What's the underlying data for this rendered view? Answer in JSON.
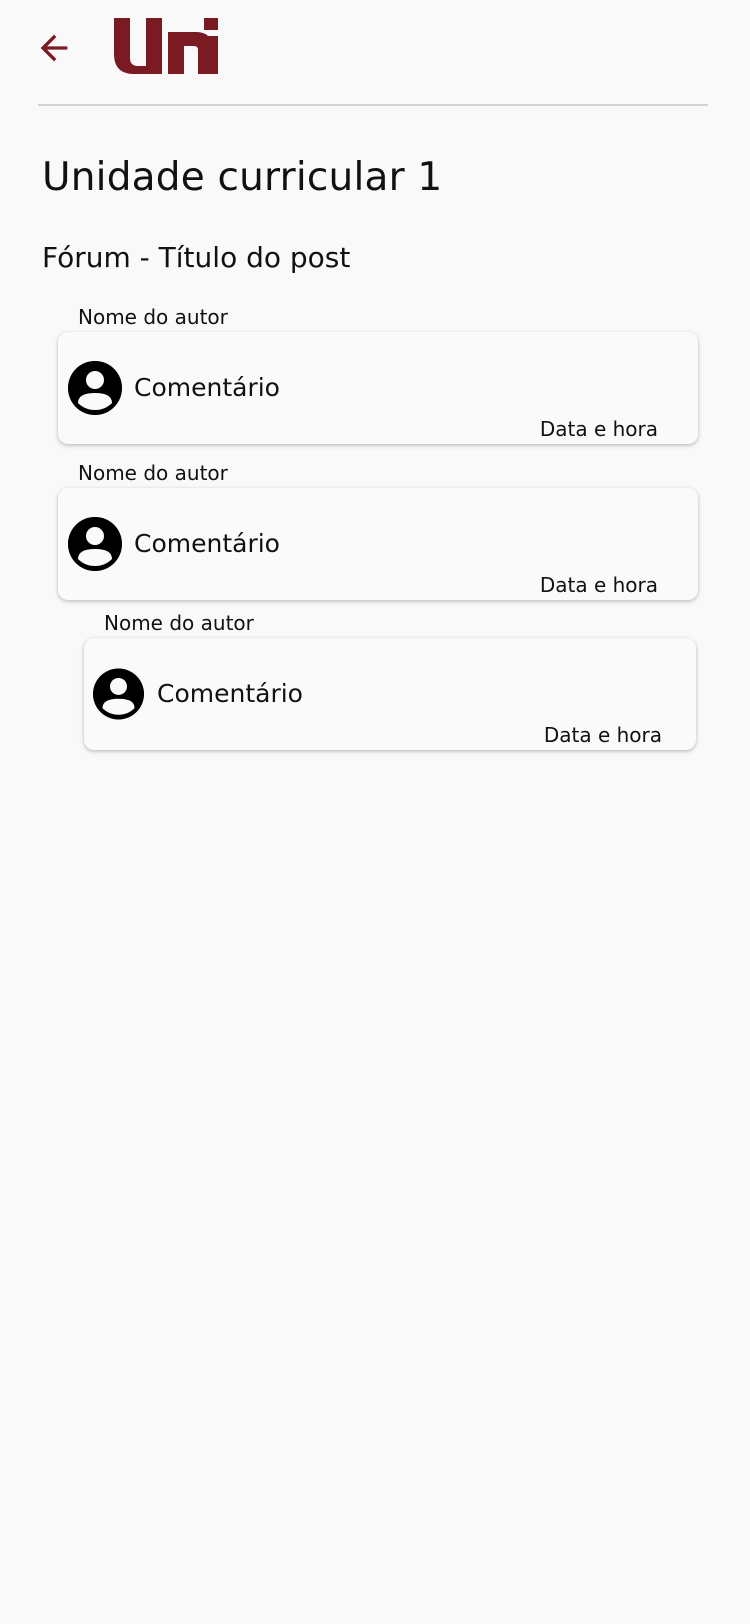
{
  "header": {
    "back_icon": "arrow-left-icon",
    "logo_text": "uni",
    "brand_color": "#7a1a22"
  },
  "page": {
    "title": "Unidade curricular 1",
    "forum_title": "Fórum - Título do post"
  },
  "comments": [
    {
      "author": "Nome do autor",
      "avatar_icon": "account-circle-icon",
      "text": "Comentário",
      "datetime": "Data e hora"
    },
    {
      "author": "Nome do autor",
      "avatar_icon": "account-circle-icon",
      "text": "Comentário",
      "datetime": "Data e hora"
    },
    {
      "author": "Nome do autor",
      "avatar_icon": "account-circle-icon",
      "text": "Comentário",
      "datetime": "Data e hora",
      "is_reply": true
    }
  ]
}
